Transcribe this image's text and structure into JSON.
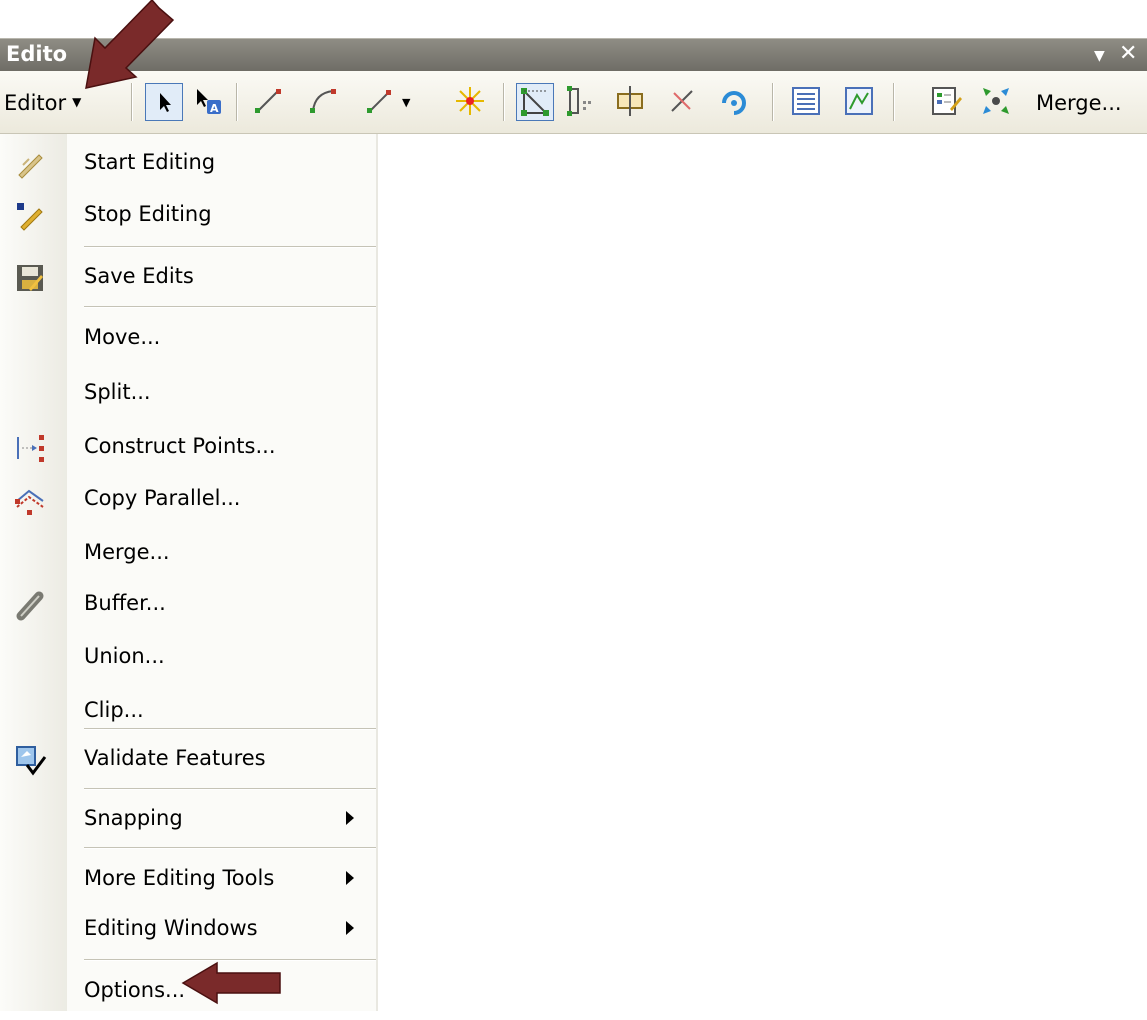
{
  "window": {
    "title": "Edito",
    "controls": {
      "dropdown": "▼",
      "close": "✕"
    }
  },
  "toolbar": {
    "editor_label": "Editor",
    "editor_caret": "▼",
    "merge_label": "Merge...",
    "buttons": [
      {
        "name": "edit-tool-icon",
        "pressed": true
      },
      {
        "name": "edit-annotation-tool-icon"
      },
      {
        "name": "straight-segment-icon"
      },
      {
        "name": "end-point-arc-icon"
      },
      {
        "name": "trace-icon"
      },
      {
        "name": "point-icon"
      },
      {
        "name": "edit-vertices-icon",
        "pressed": true
      },
      {
        "name": "reshape-feature-icon"
      },
      {
        "name": "cut-polygons-icon"
      },
      {
        "name": "split-tool-icon"
      },
      {
        "name": "rotate-tool-icon"
      },
      {
        "name": "attributes-icon"
      },
      {
        "name": "sketch-properties-icon"
      },
      {
        "name": "create-features-icon"
      },
      {
        "name": "merge-icon"
      }
    ]
  },
  "menu": {
    "items": {
      "start_editing": "Start Editing",
      "stop_editing": "Stop Editing",
      "save_edits": "Save Edits",
      "move": "Move...",
      "split": "Split...",
      "construct_points": "Construct Points...",
      "copy_parallel": "Copy Parallel...",
      "merge": "Merge...",
      "buffer": "Buffer...",
      "union": "Union...",
      "clip": "Clip...",
      "validate_features": "Validate Features",
      "snapping": "Snapping",
      "more_editing_tools": "More Editing Tools",
      "editing_windows": "Editing Windows",
      "options": "Options..."
    }
  },
  "colors": {
    "titlebar": "#7f7d75",
    "toolbar": "#f1efe3",
    "menu_background": "#fbfbf8",
    "callout_arrow": "#7a2a2a"
  }
}
